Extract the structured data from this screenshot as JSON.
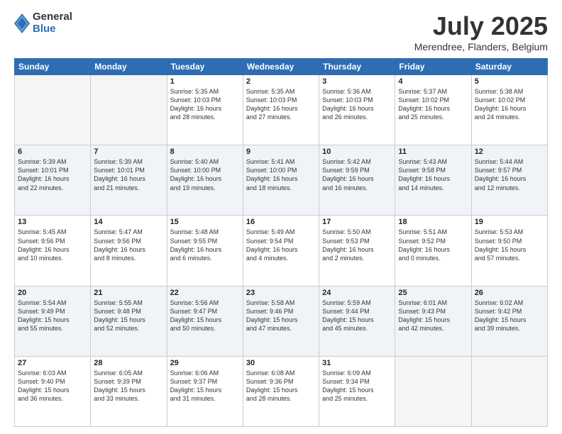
{
  "logo": {
    "general": "General",
    "blue": "Blue"
  },
  "title": "July 2025",
  "location": "Merendree, Flanders, Belgium",
  "days_of_week": [
    "Sunday",
    "Monday",
    "Tuesday",
    "Wednesday",
    "Thursday",
    "Friday",
    "Saturday"
  ],
  "weeks": [
    [
      {
        "day": "",
        "info": ""
      },
      {
        "day": "",
        "info": ""
      },
      {
        "day": "1",
        "info": "Sunrise: 5:35 AM\nSunset: 10:03 PM\nDaylight: 16 hours\nand 28 minutes."
      },
      {
        "day": "2",
        "info": "Sunrise: 5:35 AM\nSunset: 10:03 PM\nDaylight: 16 hours\nand 27 minutes."
      },
      {
        "day": "3",
        "info": "Sunrise: 5:36 AM\nSunset: 10:03 PM\nDaylight: 16 hours\nand 26 minutes."
      },
      {
        "day": "4",
        "info": "Sunrise: 5:37 AM\nSunset: 10:02 PM\nDaylight: 16 hours\nand 25 minutes."
      },
      {
        "day": "5",
        "info": "Sunrise: 5:38 AM\nSunset: 10:02 PM\nDaylight: 16 hours\nand 24 minutes."
      }
    ],
    [
      {
        "day": "6",
        "info": "Sunrise: 5:39 AM\nSunset: 10:01 PM\nDaylight: 16 hours\nand 22 minutes."
      },
      {
        "day": "7",
        "info": "Sunrise: 5:39 AM\nSunset: 10:01 PM\nDaylight: 16 hours\nand 21 minutes."
      },
      {
        "day": "8",
        "info": "Sunrise: 5:40 AM\nSunset: 10:00 PM\nDaylight: 16 hours\nand 19 minutes."
      },
      {
        "day": "9",
        "info": "Sunrise: 5:41 AM\nSunset: 10:00 PM\nDaylight: 16 hours\nand 18 minutes."
      },
      {
        "day": "10",
        "info": "Sunrise: 5:42 AM\nSunset: 9:59 PM\nDaylight: 16 hours\nand 16 minutes."
      },
      {
        "day": "11",
        "info": "Sunrise: 5:43 AM\nSunset: 9:58 PM\nDaylight: 16 hours\nand 14 minutes."
      },
      {
        "day": "12",
        "info": "Sunrise: 5:44 AM\nSunset: 9:57 PM\nDaylight: 16 hours\nand 12 minutes."
      }
    ],
    [
      {
        "day": "13",
        "info": "Sunrise: 5:45 AM\nSunset: 9:56 PM\nDaylight: 16 hours\nand 10 minutes."
      },
      {
        "day": "14",
        "info": "Sunrise: 5:47 AM\nSunset: 9:56 PM\nDaylight: 16 hours\nand 8 minutes."
      },
      {
        "day": "15",
        "info": "Sunrise: 5:48 AM\nSunset: 9:55 PM\nDaylight: 16 hours\nand 6 minutes."
      },
      {
        "day": "16",
        "info": "Sunrise: 5:49 AM\nSunset: 9:54 PM\nDaylight: 16 hours\nand 4 minutes."
      },
      {
        "day": "17",
        "info": "Sunrise: 5:50 AM\nSunset: 9:53 PM\nDaylight: 16 hours\nand 2 minutes."
      },
      {
        "day": "18",
        "info": "Sunrise: 5:51 AM\nSunset: 9:52 PM\nDaylight: 16 hours\nand 0 minutes."
      },
      {
        "day": "19",
        "info": "Sunrise: 5:53 AM\nSunset: 9:50 PM\nDaylight: 15 hours\nand 57 minutes."
      }
    ],
    [
      {
        "day": "20",
        "info": "Sunrise: 5:54 AM\nSunset: 9:49 PM\nDaylight: 15 hours\nand 55 minutes."
      },
      {
        "day": "21",
        "info": "Sunrise: 5:55 AM\nSunset: 9:48 PM\nDaylight: 15 hours\nand 52 minutes."
      },
      {
        "day": "22",
        "info": "Sunrise: 5:56 AM\nSunset: 9:47 PM\nDaylight: 15 hours\nand 50 minutes."
      },
      {
        "day": "23",
        "info": "Sunrise: 5:58 AM\nSunset: 9:46 PM\nDaylight: 15 hours\nand 47 minutes."
      },
      {
        "day": "24",
        "info": "Sunrise: 5:59 AM\nSunset: 9:44 PM\nDaylight: 15 hours\nand 45 minutes."
      },
      {
        "day": "25",
        "info": "Sunrise: 6:01 AM\nSunset: 9:43 PM\nDaylight: 15 hours\nand 42 minutes."
      },
      {
        "day": "26",
        "info": "Sunrise: 6:02 AM\nSunset: 9:42 PM\nDaylight: 15 hours\nand 39 minutes."
      }
    ],
    [
      {
        "day": "27",
        "info": "Sunrise: 6:03 AM\nSunset: 9:40 PM\nDaylight: 15 hours\nand 36 minutes."
      },
      {
        "day": "28",
        "info": "Sunrise: 6:05 AM\nSunset: 9:39 PM\nDaylight: 15 hours\nand 33 minutes."
      },
      {
        "day": "29",
        "info": "Sunrise: 6:06 AM\nSunset: 9:37 PM\nDaylight: 15 hours\nand 31 minutes."
      },
      {
        "day": "30",
        "info": "Sunrise: 6:08 AM\nSunset: 9:36 PM\nDaylight: 15 hours\nand 28 minutes."
      },
      {
        "day": "31",
        "info": "Sunrise: 6:09 AM\nSunset: 9:34 PM\nDaylight: 15 hours\nand 25 minutes."
      },
      {
        "day": "",
        "info": ""
      },
      {
        "day": "",
        "info": ""
      }
    ]
  ]
}
